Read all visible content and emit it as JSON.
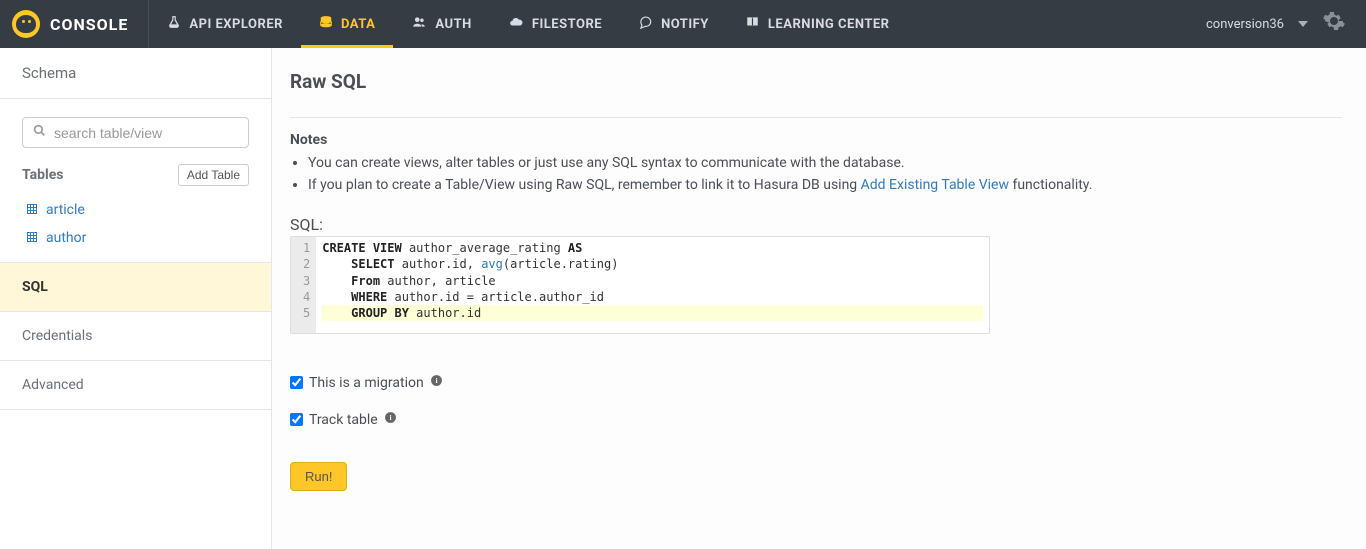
{
  "brand": "CONSOLE",
  "nav": {
    "items": [
      {
        "label": "API EXPLORER"
      },
      {
        "label": "DATA"
      },
      {
        "label": "AUTH"
      },
      {
        "label": "FILESTORE"
      },
      {
        "label": "NOTIFY"
      },
      {
        "label": "LEARNING CENTER"
      }
    ],
    "active_index": 1
  },
  "project_name": "conversion36",
  "sidebar": {
    "schema_label": "Schema",
    "search_placeholder": "search table/view",
    "tables_heading": "Tables",
    "add_table_label": "Add Table",
    "tables": [
      {
        "name": "article"
      },
      {
        "name": "author"
      }
    ],
    "links": [
      {
        "label": "SQL",
        "active": true
      },
      {
        "label": "Credentials",
        "active": false
      },
      {
        "label": "Advanced",
        "active": false
      }
    ]
  },
  "page": {
    "title": "Raw SQL",
    "notes_heading": "Notes",
    "notes": {
      "n1": "You can create views, alter tables or just use any SQL syntax to communicate with the database.",
      "n2a": "If you plan to create a Table/View using Raw SQL, remember to link it to Hasura DB using ",
      "n2_link": "Add Existing Table View",
      "n2b": " functionality."
    },
    "sql_label": "SQL:",
    "sql_code_plain": "CREATE VIEW author_average_rating AS\n    SELECT author.id, avg(article.rating)\n    From author, article\n    WHERE author.id = article.author_id\n    GROUP BY author.id",
    "line_numbers": [
      "1",
      "2",
      "3",
      "4",
      "5"
    ],
    "migration_label": "This is a migration",
    "track_label": "Track table",
    "migration_checked": true,
    "track_checked": true,
    "run_label": "Run!"
  }
}
